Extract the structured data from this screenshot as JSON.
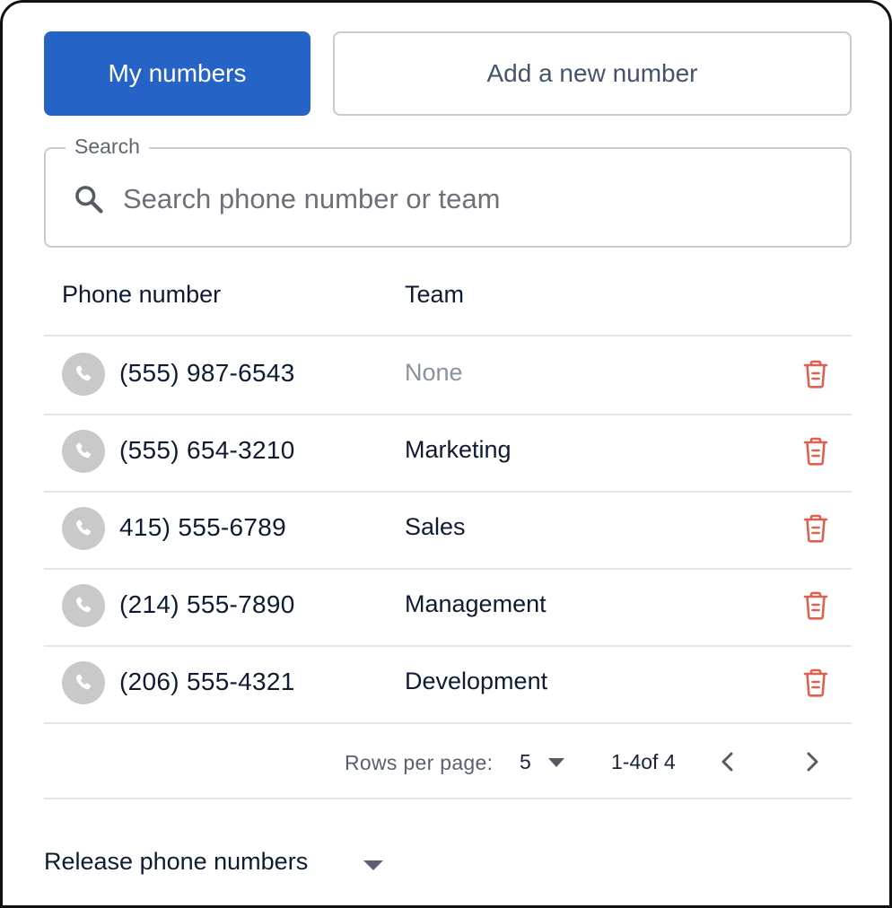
{
  "tabs": {
    "active_label": "My numbers",
    "inactive_label": "Add a new number"
  },
  "search": {
    "legend": "Search",
    "placeholder": "Search phone number or team"
  },
  "table": {
    "headers": {
      "phone": "Phone number",
      "team": "Team"
    },
    "rows": [
      {
        "phone": "(555) 987-6543",
        "team": "None"
      },
      {
        "phone": "(555) 654-3210",
        "team": "Marketing"
      },
      {
        "phone": "415) 555-6789",
        "team": "Sales"
      },
      {
        "phone": "(214) 555-7890",
        "team": "Management"
      },
      {
        "phone": "(206) 555-4321",
        "team": "Development"
      }
    ]
  },
  "pagination": {
    "rows_per_page_label": "Rows per page:",
    "rows_per_page_value": "5",
    "range": "1-4of 4"
  },
  "footer": {
    "release_label": "Release phone numbers"
  },
  "icons": {
    "search": "search-icon",
    "phone": "phone-icon",
    "delete": "trash-icon",
    "prev": "chevron-left-icon",
    "next": "chevron-right-icon",
    "dropdown": "caret-down-icon"
  },
  "colors": {
    "accent": "#2563c7",
    "delete": "#e0604f",
    "muted_text": "#8a929e"
  }
}
